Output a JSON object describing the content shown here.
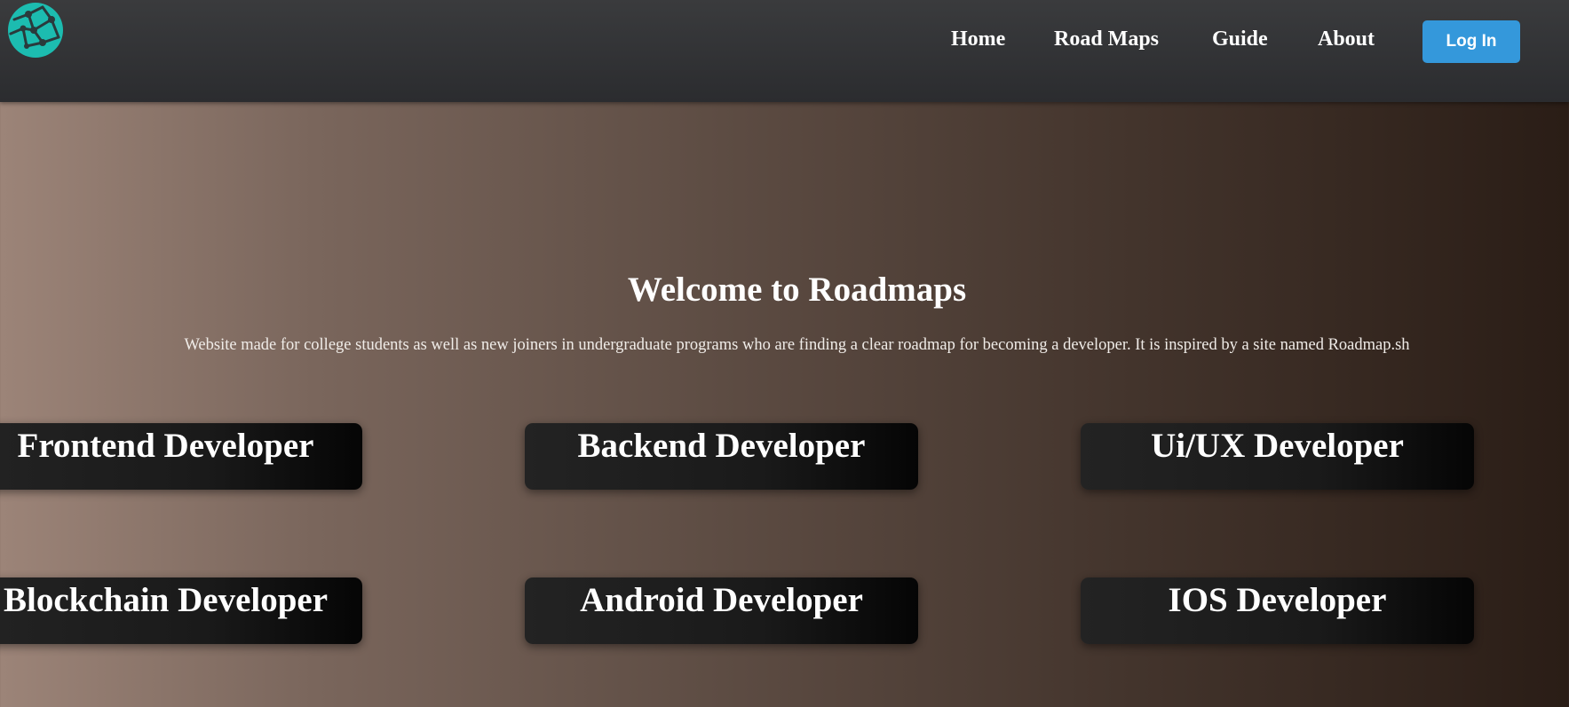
{
  "nav": {
    "logo_icon": "globe-network-icon",
    "links": [
      {
        "label": "Home"
      },
      {
        "label": "Road Maps"
      },
      {
        "label": "Guide"
      },
      {
        "label": "About"
      }
    ],
    "login_label": "Log In",
    "accent_color": "#3498db",
    "logo_color": "#1cbcb0"
  },
  "hero": {
    "title": "Welcome to Roadmaps",
    "description": "Website made for college students as well as new joiners in undergraduate programs who are finding a clear roadmap for becoming a developer. It is inspired by a site named Roadmap.sh"
  },
  "roadmaps": [
    {
      "label": "Frontend Developer"
    },
    {
      "label": "Backend Developer"
    },
    {
      "label": "Ui/UX Developer"
    },
    {
      "label": "Blockchain Developer"
    },
    {
      "label": "Android Developer"
    },
    {
      "label": "IOS Developer"
    }
  ]
}
